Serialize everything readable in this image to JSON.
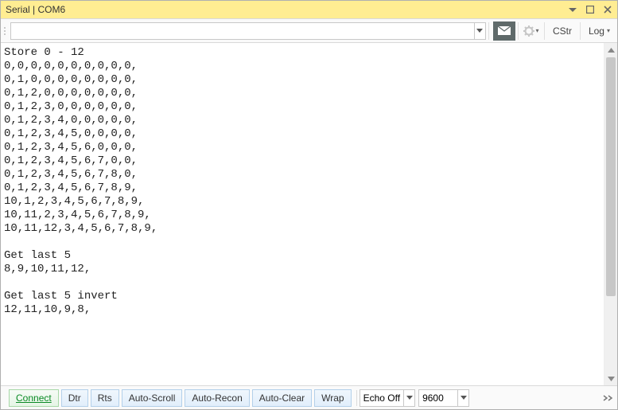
{
  "window": {
    "title": "Serial | COM6"
  },
  "toolbar": {
    "input_value": "",
    "input_placeholder": "",
    "cstr_label": "CStr",
    "log_label": "Log"
  },
  "console": {
    "lines": [
      "Store 0 - 12",
      "0,0,0,0,0,0,0,0,0,0,",
      "0,1,0,0,0,0,0,0,0,0,",
      "0,1,2,0,0,0,0,0,0,0,",
      "0,1,2,3,0,0,0,0,0,0,",
      "0,1,2,3,4,0,0,0,0,0,",
      "0,1,2,3,4,5,0,0,0,0,",
      "0,1,2,3,4,5,6,0,0,0,",
      "0,1,2,3,4,5,6,7,0,0,",
      "0,1,2,3,4,5,6,7,8,0,",
      "0,1,2,3,4,5,6,7,8,9,",
      "10,1,2,3,4,5,6,7,8,9,",
      "10,11,2,3,4,5,6,7,8,9,",
      "10,11,12,3,4,5,6,7,8,9,",
      "",
      "Get last 5",
      "8,9,10,11,12,",
      "",
      "Get last 5 invert",
      "12,11,10,9,8,",
      ""
    ]
  },
  "statusbar": {
    "connect_label": "Connect",
    "dtr_label": "Dtr",
    "rts_label": "Rts",
    "autoscroll_label": "Auto-Scroll",
    "autorecon_label": "Auto-Recon",
    "autoclear_label": "Auto-Clear",
    "wrap_label": "Wrap",
    "echo_label": "Echo Off",
    "baud_value": "9600"
  }
}
